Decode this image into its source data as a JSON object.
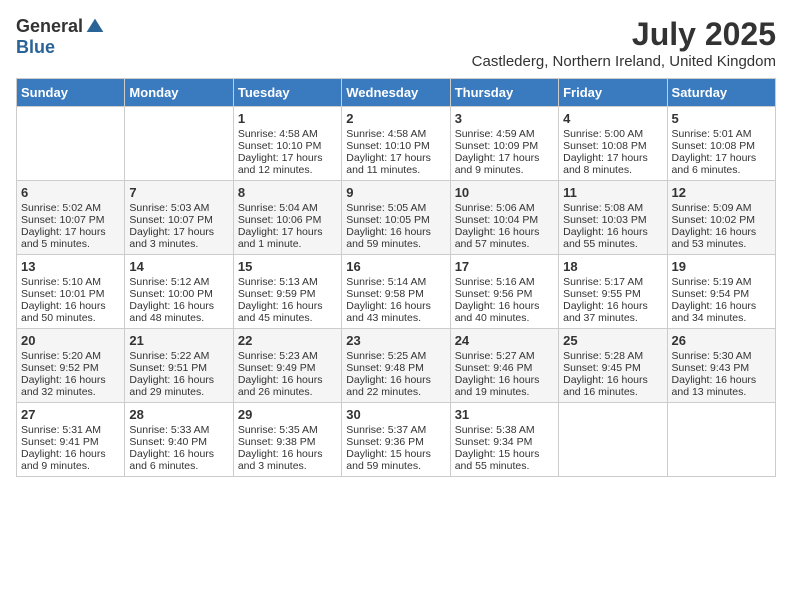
{
  "logo": {
    "general": "General",
    "blue": "Blue"
  },
  "title": "July 2025",
  "location": "Castlederg, Northern Ireland, United Kingdom",
  "days_of_week": [
    "Sunday",
    "Monday",
    "Tuesday",
    "Wednesday",
    "Thursday",
    "Friday",
    "Saturday"
  ],
  "weeks": [
    [
      {
        "day": "",
        "sunrise": "",
        "sunset": "",
        "daylight": ""
      },
      {
        "day": "",
        "sunrise": "",
        "sunset": "",
        "daylight": ""
      },
      {
        "day": "1",
        "sunrise": "Sunrise: 4:58 AM",
        "sunset": "Sunset: 10:10 PM",
        "daylight": "Daylight: 17 hours and 12 minutes."
      },
      {
        "day": "2",
        "sunrise": "Sunrise: 4:58 AM",
        "sunset": "Sunset: 10:10 PM",
        "daylight": "Daylight: 17 hours and 11 minutes."
      },
      {
        "day": "3",
        "sunrise": "Sunrise: 4:59 AM",
        "sunset": "Sunset: 10:09 PM",
        "daylight": "Daylight: 17 hours and 9 minutes."
      },
      {
        "day": "4",
        "sunrise": "Sunrise: 5:00 AM",
        "sunset": "Sunset: 10:08 PM",
        "daylight": "Daylight: 17 hours and 8 minutes."
      },
      {
        "day": "5",
        "sunrise": "Sunrise: 5:01 AM",
        "sunset": "Sunset: 10:08 PM",
        "daylight": "Daylight: 17 hours and 6 minutes."
      }
    ],
    [
      {
        "day": "6",
        "sunrise": "Sunrise: 5:02 AM",
        "sunset": "Sunset: 10:07 PM",
        "daylight": "Daylight: 17 hours and 5 minutes."
      },
      {
        "day": "7",
        "sunrise": "Sunrise: 5:03 AM",
        "sunset": "Sunset: 10:07 PM",
        "daylight": "Daylight: 17 hours and 3 minutes."
      },
      {
        "day": "8",
        "sunrise": "Sunrise: 5:04 AM",
        "sunset": "Sunset: 10:06 PM",
        "daylight": "Daylight: 17 hours and 1 minute."
      },
      {
        "day": "9",
        "sunrise": "Sunrise: 5:05 AM",
        "sunset": "Sunset: 10:05 PM",
        "daylight": "Daylight: 16 hours and 59 minutes."
      },
      {
        "day": "10",
        "sunrise": "Sunrise: 5:06 AM",
        "sunset": "Sunset: 10:04 PM",
        "daylight": "Daylight: 16 hours and 57 minutes."
      },
      {
        "day": "11",
        "sunrise": "Sunrise: 5:08 AM",
        "sunset": "Sunset: 10:03 PM",
        "daylight": "Daylight: 16 hours and 55 minutes."
      },
      {
        "day": "12",
        "sunrise": "Sunrise: 5:09 AM",
        "sunset": "Sunset: 10:02 PM",
        "daylight": "Daylight: 16 hours and 53 minutes."
      }
    ],
    [
      {
        "day": "13",
        "sunrise": "Sunrise: 5:10 AM",
        "sunset": "Sunset: 10:01 PM",
        "daylight": "Daylight: 16 hours and 50 minutes."
      },
      {
        "day": "14",
        "sunrise": "Sunrise: 5:12 AM",
        "sunset": "Sunset: 10:00 PM",
        "daylight": "Daylight: 16 hours and 48 minutes."
      },
      {
        "day": "15",
        "sunrise": "Sunrise: 5:13 AM",
        "sunset": "Sunset: 9:59 PM",
        "daylight": "Daylight: 16 hours and 45 minutes."
      },
      {
        "day": "16",
        "sunrise": "Sunrise: 5:14 AM",
        "sunset": "Sunset: 9:58 PM",
        "daylight": "Daylight: 16 hours and 43 minutes."
      },
      {
        "day": "17",
        "sunrise": "Sunrise: 5:16 AM",
        "sunset": "Sunset: 9:56 PM",
        "daylight": "Daylight: 16 hours and 40 minutes."
      },
      {
        "day": "18",
        "sunrise": "Sunrise: 5:17 AM",
        "sunset": "Sunset: 9:55 PM",
        "daylight": "Daylight: 16 hours and 37 minutes."
      },
      {
        "day": "19",
        "sunrise": "Sunrise: 5:19 AM",
        "sunset": "Sunset: 9:54 PM",
        "daylight": "Daylight: 16 hours and 34 minutes."
      }
    ],
    [
      {
        "day": "20",
        "sunrise": "Sunrise: 5:20 AM",
        "sunset": "Sunset: 9:52 PM",
        "daylight": "Daylight: 16 hours and 32 minutes."
      },
      {
        "day": "21",
        "sunrise": "Sunrise: 5:22 AM",
        "sunset": "Sunset: 9:51 PM",
        "daylight": "Daylight: 16 hours and 29 minutes."
      },
      {
        "day": "22",
        "sunrise": "Sunrise: 5:23 AM",
        "sunset": "Sunset: 9:49 PM",
        "daylight": "Daylight: 16 hours and 26 minutes."
      },
      {
        "day": "23",
        "sunrise": "Sunrise: 5:25 AM",
        "sunset": "Sunset: 9:48 PM",
        "daylight": "Daylight: 16 hours and 22 minutes."
      },
      {
        "day": "24",
        "sunrise": "Sunrise: 5:27 AM",
        "sunset": "Sunset: 9:46 PM",
        "daylight": "Daylight: 16 hours and 19 minutes."
      },
      {
        "day": "25",
        "sunrise": "Sunrise: 5:28 AM",
        "sunset": "Sunset: 9:45 PM",
        "daylight": "Daylight: 16 hours and 16 minutes."
      },
      {
        "day": "26",
        "sunrise": "Sunrise: 5:30 AM",
        "sunset": "Sunset: 9:43 PM",
        "daylight": "Daylight: 16 hours and 13 minutes."
      }
    ],
    [
      {
        "day": "27",
        "sunrise": "Sunrise: 5:31 AM",
        "sunset": "Sunset: 9:41 PM",
        "daylight": "Daylight: 16 hours and 9 minutes."
      },
      {
        "day": "28",
        "sunrise": "Sunrise: 5:33 AM",
        "sunset": "Sunset: 9:40 PM",
        "daylight": "Daylight: 16 hours and 6 minutes."
      },
      {
        "day": "29",
        "sunrise": "Sunrise: 5:35 AM",
        "sunset": "Sunset: 9:38 PM",
        "daylight": "Daylight: 16 hours and 3 minutes."
      },
      {
        "day": "30",
        "sunrise": "Sunrise: 5:37 AM",
        "sunset": "Sunset: 9:36 PM",
        "daylight": "Daylight: 15 hours and 59 minutes."
      },
      {
        "day": "31",
        "sunrise": "Sunrise: 5:38 AM",
        "sunset": "Sunset: 9:34 PM",
        "daylight": "Daylight: 15 hours and 55 minutes."
      },
      {
        "day": "",
        "sunrise": "",
        "sunset": "",
        "daylight": ""
      },
      {
        "day": "",
        "sunrise": "",
        "sunset": "",
        "daylight": ""
      }
    ]
  ]
}
